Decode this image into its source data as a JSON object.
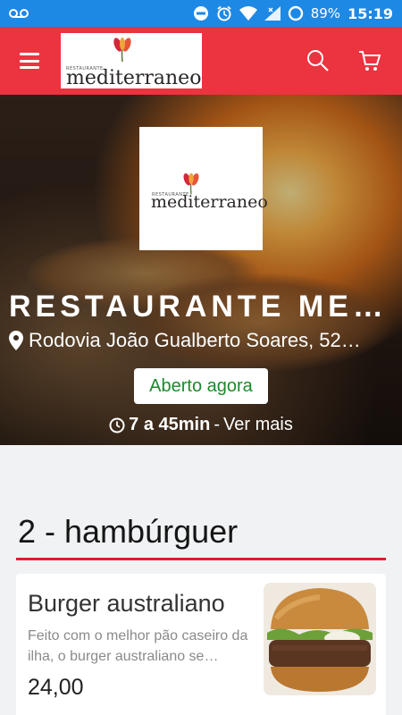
{
  "status_bar": {
    "battery": "89%",
    "time": "15:19"
  },
  "header": {
    "logo_small": "RESTAURANTE",
    "logo_text": "mediterraneo"
  },
  "hero": {
    "title": "RESTAURANTE MEDITERRANEO",
    "address": "Rodovia João Gualberto Soares, 52…",
    "status_button": "Aberto agora",
    "delivery_time": "7 a 45min",
    "separator": "-",
    "more_link": "Ver mais"
  },
  "section": {
    "title": "2 - hambúrguer"
  },
  "items": [
    {
      "name": "Burger australiano",
      "description": "Feito com o melhor pão caseiro da ilha, o burger australiano se…",
      "price": "24,00"
    }
  ],
  "colors": {
    "status_bar": "#1e88e5",
    "header": "#ec3340",
    "accent_line": "#e01f2a",
    "open_text": "#1b8a2b"
  }
}
